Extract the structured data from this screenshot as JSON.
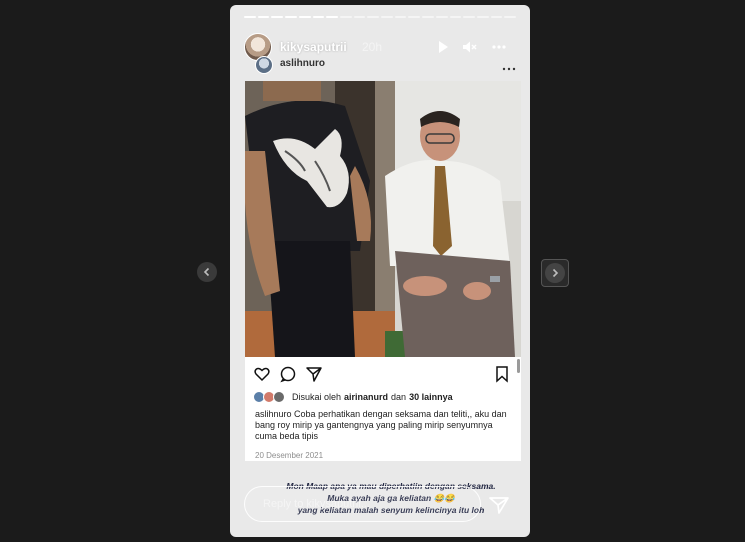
{
  "story": {
    "progress_total": 20,
    "progress_done": 7,
    "author": "kikysaputrii",
    "time": "20h",
    "shared_from": "aslihnuro"
  },
  "post": {
    "likes_prefix": "Disukai oleh",
    "likes_user": "airinanurd",
    "likes_connector": "dan",
    "likes_count": "30 lainnya",
    "caption_user": "aslihnuro",
    "caption_text": "Coba perhatikan  dengan seksama dan teliti,, aku dan bang roy  mirip ya  gantengnya  yang paling  mirip senyumnya  cuma beda tipis",
    "date": "20 Desember 2021"
  },
  "overlay_text": [
    "Mon Maap apa ya mau diperhatiin dengan seksama.",
    "Muka ayah aja ga keliatan 😂😂",
    "yang keliatan malah senyum kelincinya itu loh"
  ],
  "reply": {
    "placeholder": "Reply to kikysaputrii..."
  },
  "icons": {
    "play": "play-icon",
    "mute": "mute-icon",
    "more": "more-icon",
    "like": "heart-icon",
    "comment": "comment-icon",
    "share": "share-icon",
    "save": "bookmark-icon",
    "send": "send-icon",
    "prev": "chevron-left-icon",
    "next": "chevron-right-icon"
  }
}
